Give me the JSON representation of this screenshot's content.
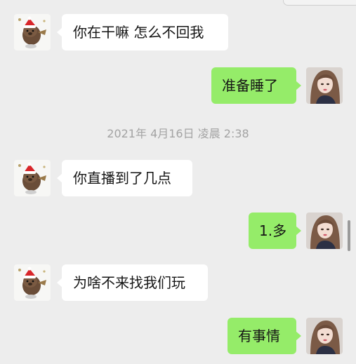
{
  "chat": {
    "timestamp": "2021年 4月16日 凌晨 2:38",
    "messages": [
      {
        "side": "in",
        "text": "你在干嘛 怎么不回我"
      },
      {
        "side": "out",
        "text": "准备睡了"
      },
      {
        "side": "in",
        "text": "你直播到了几点"
      },
      {
        "side": "out",
        "text": "1.多"
      },
      {
        "side": "in",
        "text": "为啥不来找我们玩"
      },
      {
        "side": "out",
        "text": "有事情"
      }
    ]
  },
  "colors": {
    "background": "#ededed",
    "incoming_bubble": "#ffffff",
    "outgoing_bubble": "#95ec69",
    "timestamp_text": "#a3a3a3"
  },
  "icons": {
    "contact_avatar": "brown-bear-christmas-hat-avatar",
    "self_avatar": "girl-portrait-avatar"
  }
}
